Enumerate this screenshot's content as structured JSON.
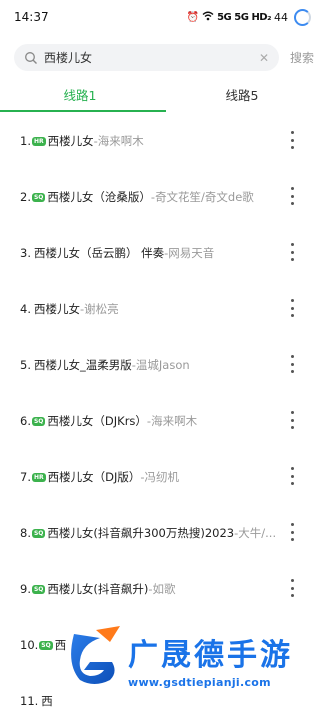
{
  "status_bar": {
    "time": "14:37",
    "network_1": "5G",
    "network_2": "5G",
    "hd": "HD₂",
    "battery": "44"
  },
  "search": {
    "query": "西楼儿女",
    "button_label": "搜索"
  },
  "tabs": [
    {
      "label": "线路1",
      "active": true
    },
    {
      "label": "线路5",
      "active": false
    }
  ],
  "songs": [
    {
      "index": "1.",
      "badge": "HR",
      "title": "西楼儿女",
      "sep": "-",
      "artist": "海来啊木"
    },
    {
      "index": "2.",
      "badge": "SQ",
      "title": "西楼儿女（沧桑版）",
      "sep": "-",
      "artist": "奇文花笙/奇文de歌"
    },
    {
      "index": "3.",
      "badge": "",
      "title": "西楼儿女（岳云鹏） 伴奏",
      "sep": "-",
      "artist": "网易天音"
    },
    {
      "index": "4.",
      "badge": "",
      "title": "西楼儿女",
      "sep": "-",
      "artist": "谢松亮"
    },
    {
      "index": "5.",
      "badge": "",
      "title": "西楼儿女_温柔男版",
      "sep": "-",
      "artist": "温城Jason"
    },
    {
      "index": "6.",
      "badge": "SQ",
      "title": "西楼儿女（DJKrs）",
      "sep": "-",
      "artist": "海来啊木"
    },
    {
      "index": "7.",
      "badge": "HR",
      "title": "西楼儿女（DJ版）",
      "sep": "-",
      "artist": "冯纫机"
    },
    {
      "index": "8.",
      "badge": "SQ",
      "title": "西楼儿女(抖音飙升300万热搜)2023",
      "sep": "-",
      "artist": "大牛/..."
    },
    {
      "index": "9.",
      "badge": "SQ",
      "title": "西楼儿女(抖音飙升)",
      "sep": "-",
      "artist": "如歌"
    },
    {
      "index": "10.",
      "badge": "SQ",
      "title": "西",
      "sep": "",
      "artist": ""
    },
    {
      "index": "11.",
      "badge": "",
      "title": "西",
      "sep": "",
      "artist": ""
    }
  ],
  "watermark": {
    "title": "广晟德手游",
    "url": "www.gsdtiepianji.com"
  },
  "colors": {
    "accent": "#27b150",
    "badge": "#3cb24d",
    "watermark": "#1a73e8"
  }
}
